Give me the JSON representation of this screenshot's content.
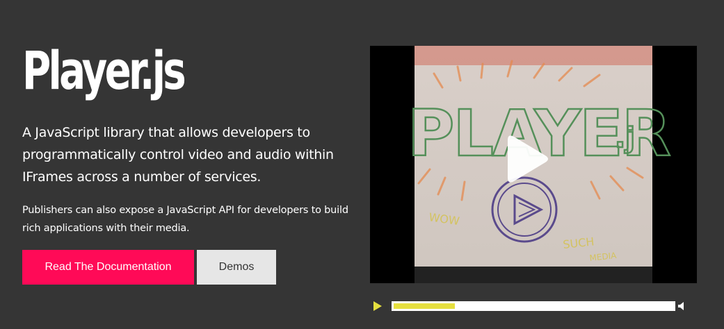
{
  "hero": {
    "title": "Player.js",
    "lead": "A JavaScript library that allows developers to programmatically control video and audio within IFrames across a number of services.",
    "sub": "Publishers can also expose a JavaScript API for developers to build rich applications with their media."
  },
  "buttons": {
    "docs_label": "Read The Documentation",
    "demos_label": "Demos"
  },
  "video": {
    "poster_icon": "player-js-whiteboard-drawing",
    "play_icon": "play-icon"
  },
  "controls": {
    "play_icon": "play-icon",
    "progress": 0.22,
    "volume_icon": "volume-icon"
  },
  "colors": {
    "background": "#353535",
    "primary_button": "#ff0a57",
    "secondary_button": "#e6e6e6",
    "progress_fill": "#e5df3f"
  }
}
